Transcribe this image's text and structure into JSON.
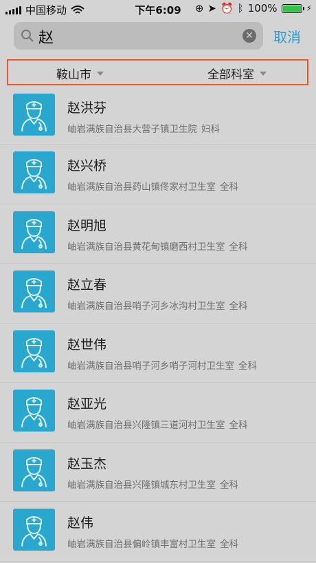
{
  "status_bar": {
    "carrier": "中国移动",
    "time": "下午6:09",
    "battery_text": "100%",
    "battery_level": 1.0,
    "battery_color": "#35c24b"
  },
  "search": {
    "query": "赵",
    "cancel_label": "取消"
  },
  "filters": {
    "city": "鞍山市",
    "department": "全部科室"
  },
  "doctors": [
    {
      "name": "赵洪芬",
      "hospital": "岫岩满族自治县大营子镇卫生院",
      "dept": "妇科"
    },
    {
      "name": "赵兴桥",
      "hospital": "岫岩满族自治县药山镇佟家村卫生室",
      "dept": "全科"
    },
    {
      "name": "赵明旭",
      "hospital": "岫岩满族自治县黄花甸镇磨西村卫生室",
      "dept": "全科"
    },
    {
      "name": "赵立春",
      "hospital": "岫岩满族自治县哨子河乡冰沟村卫生室",
      "dept": "全科"
    },
    {
      "name": "赵世伟",
      "hospital": "岫岩满族自治县哨子河乡哨子河村卫生室",
      "dept": "全科"
    },
    {
      "name": "赵亚光",
      "hospital": "岫岩满族自治县兴隆镇三道河村卫生室",
      "dept": "全科"
    },
    {
      "name": "赵玉杰",
      "hospital": "岫岩满族自治县兴隆镇城东村卫生室",
      "dept": "全科"
    },
    {
      "name": "赵伟",
      "hospital": "岫岩满族自治县偏岭镇丰富村卫生室",
      "dept": "全科"
    }
  ],
  "colors": {
    "accent": "#2a9fd1",
    "avatar_bg": "#2aa7cf",
    "filter_highlight": "#e8582b"
  }
}
